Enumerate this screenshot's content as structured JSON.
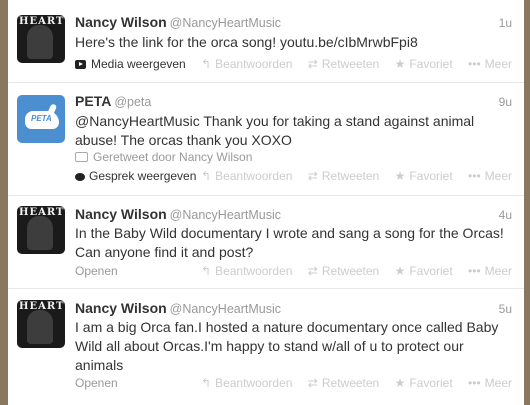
{
  "tweets": [
    {
      "name": "Nancy Wilson",
      "handle": "@NancyHeartMusic",
      "time": "1u",
      "text": "Here's the link for the orca song! youtu.be/cIbMrwbFpi8",
      "expand": "Media weergeven"
    },
    {
      "name": "PETA",
      "handle": "@peta",
      "time": "9u",
      "mention": "@NancyHeartMusic",
      "text": " Thank you for taking a stand against animal abuse! The orcas thank you XOXO",
      "retweeted_by": "Geretweet door Nancy Wilson",
      "expand": "Gesprek weergeven"
    },
    {
      "name": "Nancy Wilson",
      "handle": "@NancyHeartMusic",
      "time": "4u",
      "text": "In the Baby Wild documentary I wrote and sang a song for the Orcas! Can anyone find it and post?",
      "expand": "Openen"
    },
    {
      "name": "Nancy Wilson",
      "handle": "@NancyHeartMusic",
      "time": "5u",
      "text": "I am a big Orca fan.I hosted a nature documentary once called Baby Wild all about Orcas.I'm happy to stand w/all of u to protect our animals",
      "expand": "Openen"
    }
  ],
  "actions": {
    "reply": "Beantwoorden",
    "retweet": "Retweeten",
    "favorite": "Favoriet",
    "more": "Meer"
  },
  "icons": {
    "reply": "reply-arrow-icon",
    "retweet": "retweet-icon",
    "favorite": "star-icon",
    "more": "more-dots-icon",
    "media": "media-play-icon",
    "conversation": "speech-bubble-icon"
  }
}
